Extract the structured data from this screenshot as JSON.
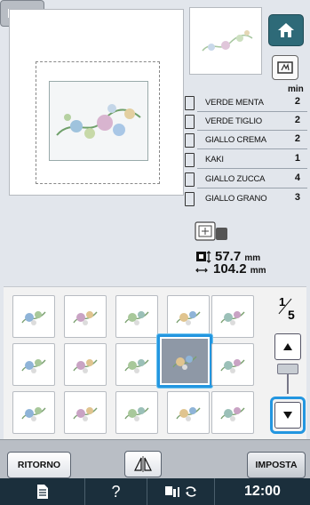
{
  "threads": {
    "min_label": "min",
    "items": [
      {
        "name": "VERDE MENTA",
        "minutes": "2",
        "color": "#333333"
      },
      {
        "name": "VERDE TIGLIO",
        "minutes": "2",
        "color": "#333333"
      },
      {
        "name": "GIALLO CREMA",
        "minutes": "2",
        "color": "#333333"
      },
      {
        "name": "KAKI",
        "minutes": "1",
        "color": "#333333"
      },
      {
        "name": "GIALLO ZUCCA",
        "minutes": "4",
        "color": "#333333"
      },
      {
        "name": "GIALLO GRANO",
        "minutes": "3",
        "color": "#333333"
      }
    ]
  },
  "size": {
    "width_value": "57.7",
    "height_value": "104.2",
    "unit": "mm"
  },
  "pagination": {
    "current": "1",
    "total": "5"
  },
  "patterns": {
    "selected_index": 8,
    "icons": [
      "bear-bow-motif-icon",
      "ribbon-bow-motif-icon",
      "small-floral-spray-icon",
      "floral-corner-icon",
      "vine-sprig-icon",
      "heart-floral-icon",
      "eye-leaf-icon",
      "floral-border-icon",
      "floral-bouquet-icon",
      "floral-swirl-icon",
      "heart-ornament-icon",
      "bride-silhouette-icon",
      "butterfly-flowers-icon",
      "rose-ribbon-icon",
      "floral-wreath-icon"
    ]
  },
  "buttons": {
    "ritorno": "RITORNO",
    "imposta": "IMPOSTA"
  },
  "status": {
    "time": "12:00",
    "help": "?"
  },
  "colors": {
    "accent_selection": "#2396e0",
    "home_button": "#2e6a78",
    "status_bar": "#1b2f3c"
  }
}
